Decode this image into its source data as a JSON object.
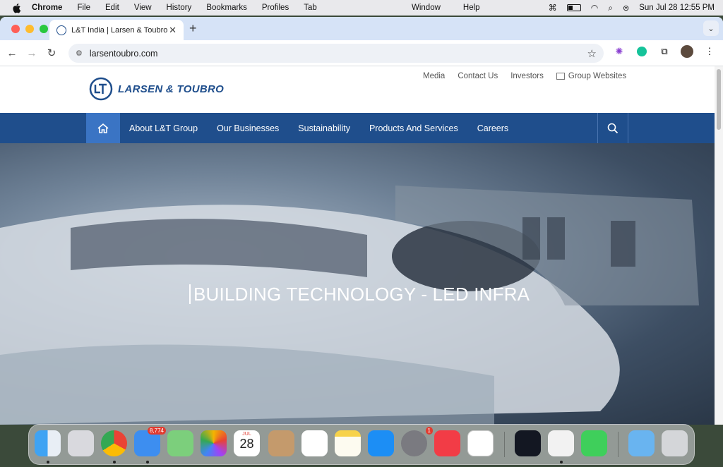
{
  "menubar": {
    "app": "Chrome",
    "items": [
      "File",
      "Edit",
      "View",
      "History",
      "Bookmarks",
      "Profiles",
      "Tab"
    ],
    "center_items": [
      "Window",
      "Help"
    ],
    "datetime": "Sun Jul 28  12:55 PM"
  },
  "browser": {
    "tab_title": "L&T India | Larsen & Toubro",
    "url": "larsentoubro.com"
  },
  "site": {
    "topnav": [
      "Media",
      "Contact Us",
      "Investors",
      "Group Websites"
    ],
    "logo_text": "LARSEN & TOUBRO",
    "mainnav": [
      "About L&T Group",
      "Our Businesses",
      "Sustainability",
      "Products And Services",
      "Careers"
    ],
    "hero_title": "BUILDING TECHNOLOGY - LED INFRA",
    "brand_color": "#1f4e8c"
  },
  "dock": {
    "mail_badge": "8,774",
    "calendar_month": "JUL",
    "calendar_day": "28",
    "settings_badge": "1"
  }
}
